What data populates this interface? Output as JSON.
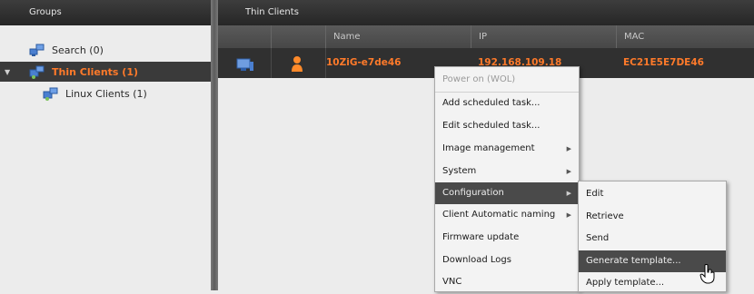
{
  "groups_panel": {
    "header": "Groups",
    "items": [
      {
        "label": "Search (0)",
        "icon": "search-computers-icon"
      },
      {
        "label": "Thin Clients (1)",
        "icon": "thin-clients-group-icon",
        "selected": true,
        "expander": "▼"
      },
      {
        "label": "Linux Clients (1)",
        "icon": "linux-clients-group-icon"
      }
    ]
  },
  "clients_panel": {
    "header": "Thin Clients",
    "columns": [
      "Name",
      "IP",
      "MAC"
    ],
    "rows": [
      {
        "name": "10ZiG-e7de46",
        "ip": "192.168.109.18",
        "mac": "EC21E5E7DE46",
        "icons": [
          "monitor-icon",
          "user-icon"
        ]
      }
    ]
  },
  "context_menu": {
    "items": [
      {
        "label": "Power on (WOL)",
        "disabled": true
      },
      {
        "label": "Add scheduled task..."
      },
      {
        "label": "Edit scheduled task..."
      },
      {
        "label": "Image management",
        "submenu": true
      },
      {
        "label": "System",
        "submenu": true
      },
      {
        "label": "Configuration",
        "submenu": true,
        "highlighted": true
      },
      {
        "label": "Client Automatic naming",
        "submenu": true
      },
      {
        "label": "Firmware update"
      },
      {
        "label": "Download Logs"
      },
      {
        "label": "VNC"
      }
    ],
    "submenu_arrow": "▶"
  },
  "configuration_submenu": {
    "items": [
      {
        "label": "Edit"
      },
      {
        "label": "Retrieve"
      },
      {
        "label": "Send"
      },
      {
        "label": "Generate template...",
        "highlighted": true
      },
      {
        "label": "Apply template..."
      }
    ]
  },
  "colors": {
    "accent_orange": "#ff7a2a",
    "header_dark": "#262626",
    "row_dark": "#303030",
    "menu_highlight": "#4a4a4a"
  }
}
